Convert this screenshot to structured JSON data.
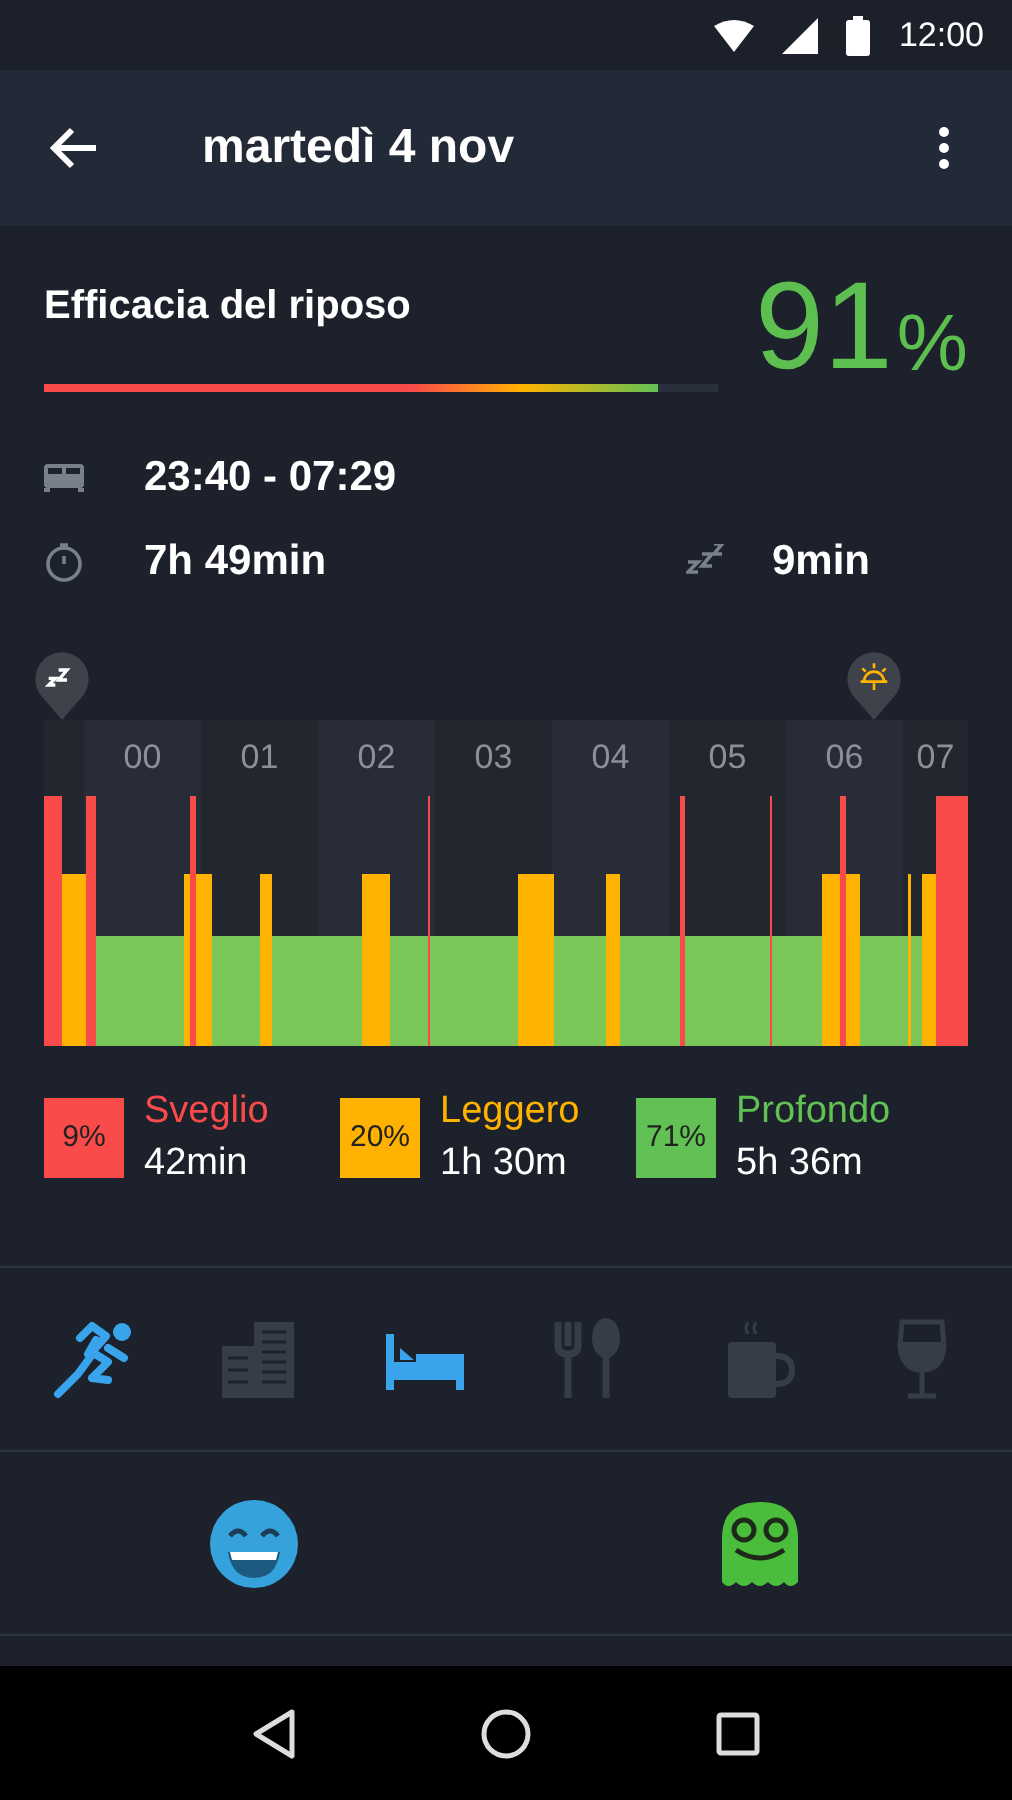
{
  "status_bar": {
    "time": "12:00"
  },
  "app_bar": {
    "title": "martedì 4 nov"
  },
  "efficiency": {
    "label": "Efficacia del riposo",
    "value": "91",
    "unit": "%",
    "level": 0.91
  },
  "times": {
    "range": "23:40 - 07:29",
    "duration": "7h 49min",
    "snooze": "9min"
  },
  "hypnogram": {
    "hours": [
      "00",
      "01",
      "02",
      "03",
      "04",
      "05",
      "06",
      "07"
    ]
  },
  "stages": [
    {
      "percent": "9%",
      "label": "Sveglio",
      "duration": "42min",
      "color": "#fa4b4b"
    },
    {
      "percent": "20%",
      "label": "Leggero",
      "duration": "1h 30m",
      "color": "#ffb300"
    },
    {
      "percent": "71%",
      "label": "Profondo",
      "duration": "5h 36m",
      "color": "#62c154"
    }
  ],
  "activities": [
    {
      "kind": "sport",
      "selected": true
    },
    {
      "kind": "work",
      "selected": false
    },
    {
      "kind": "bed",
      "selected": true
    },
    {
      "kind": "food",
      "selected": false
    },
    {
      "kind": "coffee",
      "selected": false
    },
    {
      "kind": "wine",
      "selected": false
    }
  ],
  "moods": [
    {
      "kind": "smile"
    },
    {
      "kind": "ghost"
    }
  ]
}
